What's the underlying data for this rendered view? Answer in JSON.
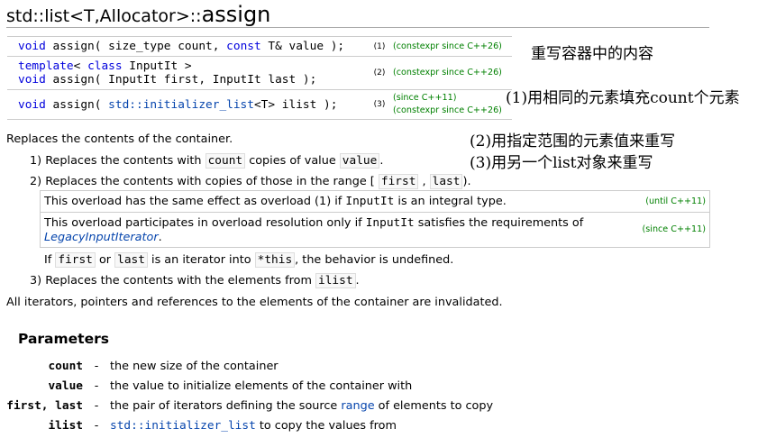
{
  "title": {
    "prefix": "std::list<T,Allocator>::",
    "name": "assign"
  },
  "declarations": [
    {
      "lines": [
        {
          "kw": "void",
          "rest": " assign( size_type count, ",
          "kw2": "const",
          "rest2": " T& value );"
        }
      ],
      "number": "(1)",
      "versions": [
        "(constexpr since C++26)"
      ]
    },
    {
      "lines": [
        {
          "kw": "template",
          "rest": "< ",
          "kw2": "class",
          "rest2": " InputIt >"
        },
        {
          "kw": "void",
          "rest": " assign( InputIt first, InputIt last );",
          "kw2": "",
          "rest2": ""
        }
      ],
      "number": "(2)",
      "versions": [
        "(constexpr since C++26)"
      ]
    },
    {
      "lines": [
        {
          "kw": "void",
          "rest": " assign( ",
          "link": "std::initializer_list",
          "rest2": "<T> ilist );"
        }
      ],
      "number": "(3)",
      "versions": [
        "(since C++11)",
        "(constexpr since C++26)"
      ]
    }
  ],
  "notes": {
    "n0": "重写容器中的内容",
    "n1": "(1)用相同的元素填充count个元素",
    "n2": "(2)用指定范围的元素值来重写",
    "n3": "(3)用另一个list对象来重写"
  },
  "body": {
    "intro": "Replaces the contents of the container.",
    "item1": {
      "num": "1)",
      "a": "Replaces the contents with ",
      "c1": "count",
      "b": " copies of value ",
      "c2": "value",
      "end": "."
    },
    "item2": {
      "num": "2)",
      "a": "Replaces the contents with copies of those in the range ",
      "open": "[",
      "c1": "first",
      "comma": ",",
      "c2": "last",
      "close": ")."
    },
    "overload_box": {
      "row1_a": "This overload has the same effect as overload (1) if ",
      "row1_code": "InputIt",
      "row1_b": " is an integral type.",
      "row1_ver": "(until C++11)",
      "row2_a": "This overload participates in overload resolution only if ",
      "row2_code": "InputIt",
      "row2_b": " satisfies the requirements of",
      "row2_link": "LegacyInputIterator",
      "row2_end": ".",
      "row2_ver": "(since C++11)"
    },
    "ub": {
      "a": "If ",
      "c1": "first",
      "or": " or ",
      "c2": "last",
      "b": " is an iterator into ",
      "c3": "*this",
      "c": ", the behavior is undefined."
    },
    "item3": {
      "num": "3)",
      "a": "Replaces the contents with the elements from ",
      "c1": "ilist",
      "end": "."
    },
    "invalidate": "All iterators, pointers and references to the elements of the container are invalidated."
  },
  "parameters": {
    "heading": "Parameters",
    "items": [
      {
        "name": "count",
        "dash": "-",
        "desc": "the new size of the container",
        "link": "",
        "desc2": ""
      },
      {
        "name": "value",
        "dash": "-",
        "desc": "the value to initialize elements of the container with",
        "link": "",
        "desc2": ""
      },
      {
        "name": "first, last",
        "dash": "-",
        "desc": "the pair of iterators defining the source ",
        "link": "range",
        "desc2": " of elements to copy"
      },
      {
        "name": "ilist",
        "dash": "-",
        "desc": "",
        "link": "std::initializer_list",
        "desc2": " to copy the values from"
      }
    ]
  },
  "colors": {
    "keyword": "#0000dd",
    "link": "#0645ad",
    "version": "#008000"
  }
}
